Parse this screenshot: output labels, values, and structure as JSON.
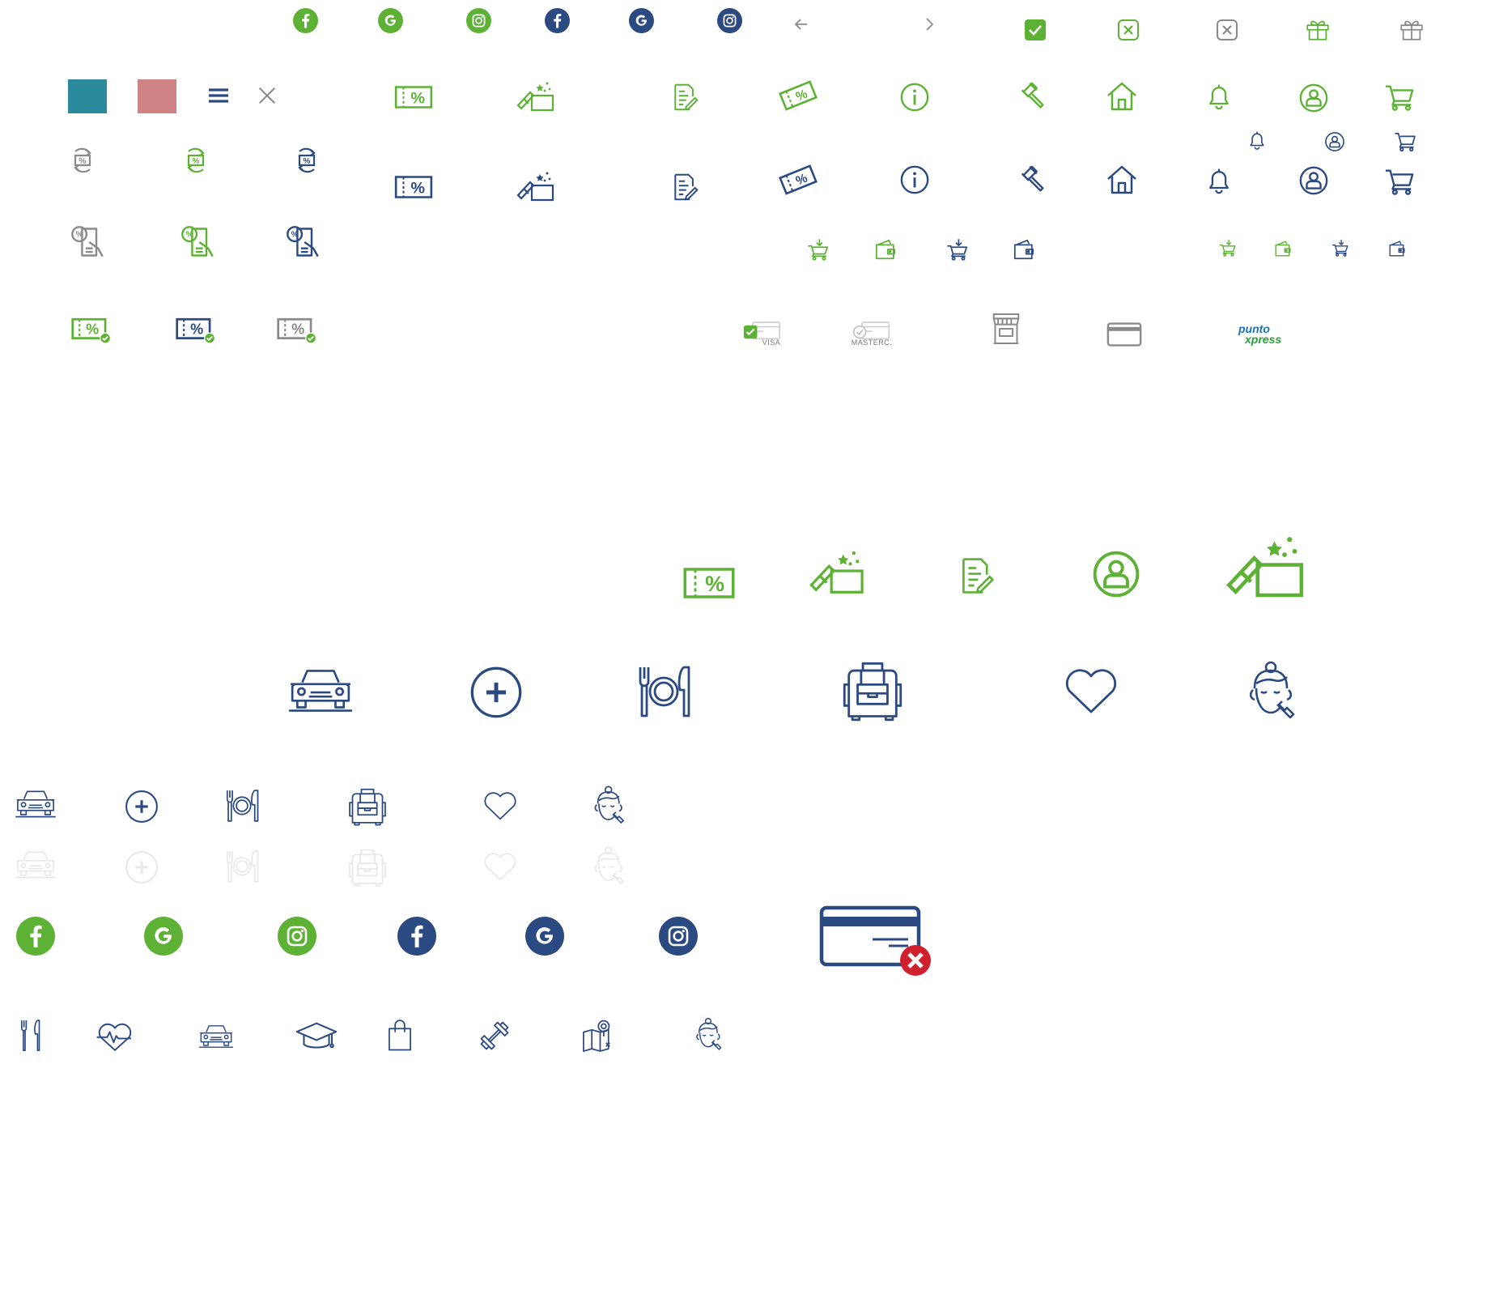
{
  "colors": {
    "green": "#5db135",
    "blue": "#2c4a82",
    "gray": "#8a8a8a",
    "teal": "#2b8b9c",
    "rose": "#cf8382",
    "error_red": "#d0202e",
    "punto_blue": "#1d6fb8",
    "punto_green": "#28a03c"
  },
  "swatches": [
    "#2b8b9c",
    "#cf8382"
  ],
  "payment": {
    "visa_caption": "VISA",
    "mastercard_caption": "MASTERC.",
    "logo_part1": "punto",
    "logo_part2": "xpress"
  },
  "icon_rows": {
    "social": [
      "facebook-icon",
      "google-icon",
      "instagram-icon"
    ],
    "nav": [
      "arrow-left-icon",
      "chevron-right-icon"
    ],
    "checkboxes": [
      "checkbox-checked-icon",
      "checkbox-close-green-icon",
      "checkbox-close-gray-icon"
    ],
    "main": [
      "coupon-icon",
      "gift-box-icon",
      "document-icon",
      "ticket-icon",
      "info-icon",
      "auction-icon",
      "home-icon",
      "bell-icon",
      "user-circle-icon",
      "cart-icon"
    ],
    "categories": [
      "car-icon",
      "plus-circle-icon",
      "restaurant-icon",
      "backpack-icon",
      "heart-icon",
      "beauty-icon"
    ],
    "bottom": [
      "cutlery-icon",
      "health-icon",
      "car-icon",
      "graduation-icon",
      "shopping-bag-icon",
      "fitness-icon",
      "map-icon",
      "beauty-icon"
    ]
  }
}
